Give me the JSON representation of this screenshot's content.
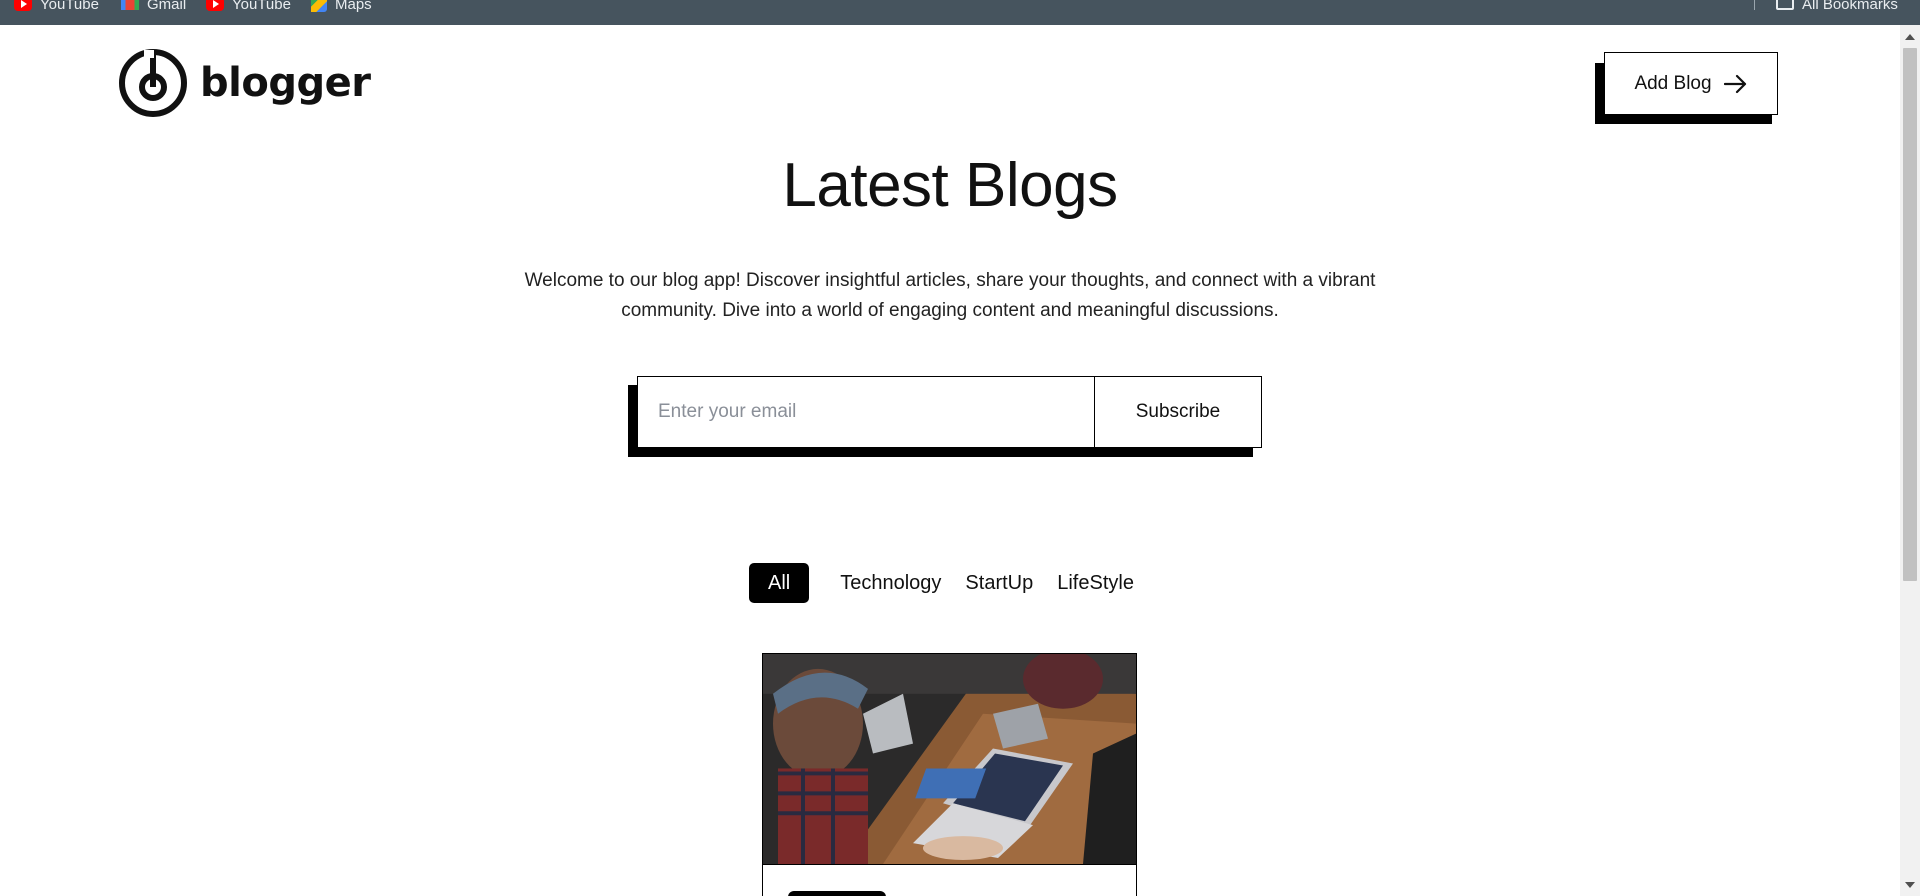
{
  "bookmarks": [
    {
      "label": "YouTube",
      "icon": "youtube-icon"
    },
    {
      "label": "Gmail",
      "icon": "gmail-icon"
    },
    {
      "label": "YouTube",
      "icon": "youtube-icon"
    },
    {
      "label": "Maps",
      "icon": "maps-icon"
    }
  ],
  "bookmarks_right": {
    "label": "All Bookmarks",
    "icon": "folder-icon"
  },
  "header": {
    "logo_text": "blogger",
    "add_blog_label": "Add Blog"
  },
  "hero": {
    "title": "Latest Blogs",
    "intro_line1": "Welcome to our blog app! Discover insightful articles, share your thoughts, and connect with a vibrant",
    "intro_line2": "community. Dive into a world of engaging content and meaningful discussions."
  },
  "subscribe": {
    "email_placeholder": "Enter your email",
    "email_value": "",
    "button_label": "Subscribe"
  },
  "categories": {
    "items": [
      "All",
      "Technology",
      "StartUp",
      "LifeStyle"
    ],
    "active": "All"
  },
  "colors": {
    "bookmarks_bar": "#46545e",
    "accent": "#000000",
    "background": "#ffffff"
  }
}
